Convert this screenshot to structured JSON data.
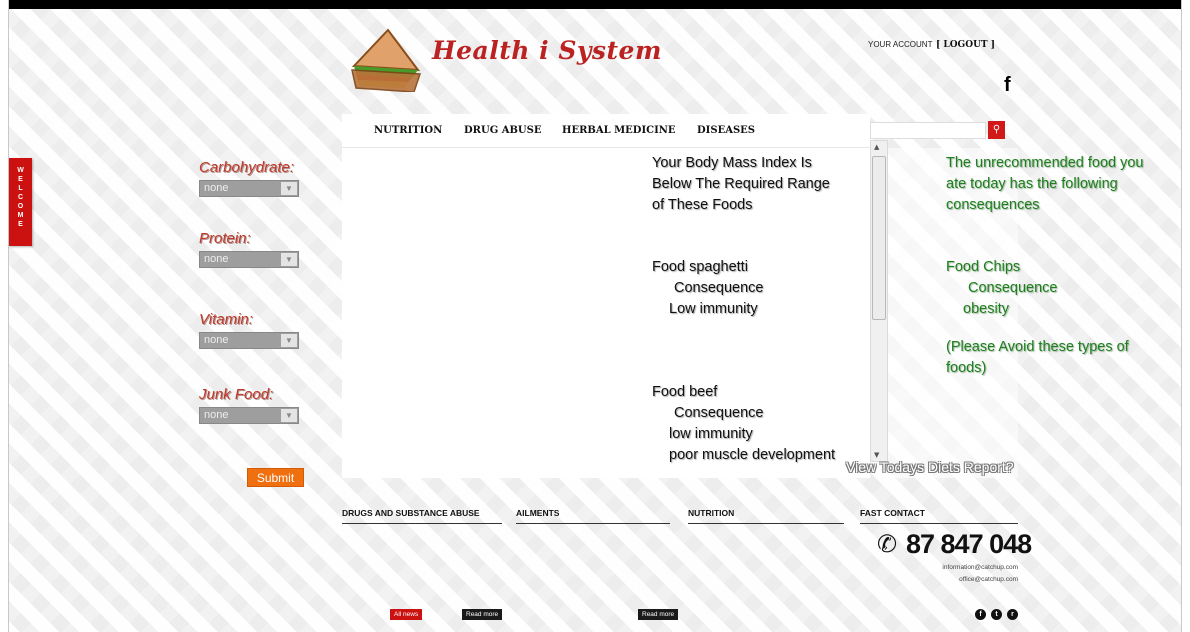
{
  "header": {
    "brand": "Health i System",
    "account_label": "YOUR ACCOUNT",
    "logout_label": "[ LOGOUT ]",
    "facebook_glyph": "f"
  },
  "nav": {
    "items": [
      "NUTRITION",
      "DRUG ABUSE",
      "HERBAL MEDICINE",
      "DISEASES"
    ]
  },
  "welcome_tab": {
    "letters": [
      "W",
      "E",
      "L",
      "C",
      "O",
      "M",
      "E"
    ]
  },
  "form": {
    "fields": [
      {
        "label": "Carbohydrate:",
        "value": "none"
      },
      {
        "label": "Protein:",
        "value": "none"
      },
      {
        "label": "Vitamin:",
        "value": "none"
      },
      {
        "label": "Junk Food:",
        "value": "none"
      }
    ],
    "submit_label": "Submit"
  },
  "report": {
    "bmi_heading": [
      "Your Body Mass Index Is",
      "Below The Required Range",
      "of These Foods"
    ],
    "foods": [
      {
        "food": "Food spaghetti",
        "label": "Consequence",
        "consequences": [
          "Low immunity"
        ]
      },
      {
        "food": "Food beef",
        "label": "Consequence",
        "consequences": [
          "low immunity",
          "poor muscle development"
        ]
      }
    ],
    "unrecommended_heading": [
      "The unrecommended food you",
      "ate today has the following",
      "consequences"
    ],
    "unrecommended": {
      "food": "Food Chips",
      "label": "Consequence",
      "consequence": "obesity"
    },
    "advice": [
      "(Please Avoid these types of",
      "foods)"
    ],
    "diet_report_link": "View Todays Diets Report?"
  },
  "footer": {
    "headings": [
      "DRUGS AND SUBSTANCE ABUSE",
      "AILMENTS",
      "NUTRITION",
      "FAST CONTACT"
    ],
    "phone": "87 847 048",
    "emails": [
      "information@catchup.com",
      "office@catchup.com"
    ],
    "all_news_label": "All news",
    "read_more_label": "Read more",
    "social_glyphs": [
      "f",
      "t",
      "r"
    ]
  },
  "colors": {
    "brand_red": "#cc1111",
    "label_red": "#c0392b",
    "advice_green": "#1d7f1d",
    "submit_orange": "#f06f0f"
  },
  "icons": [
    "sandwich-logo-icon",
    "facebook-icon",
    "search-icon",
    "phone-icon",
    "twitter-icon",
    "rss-icon"
  ]
}
